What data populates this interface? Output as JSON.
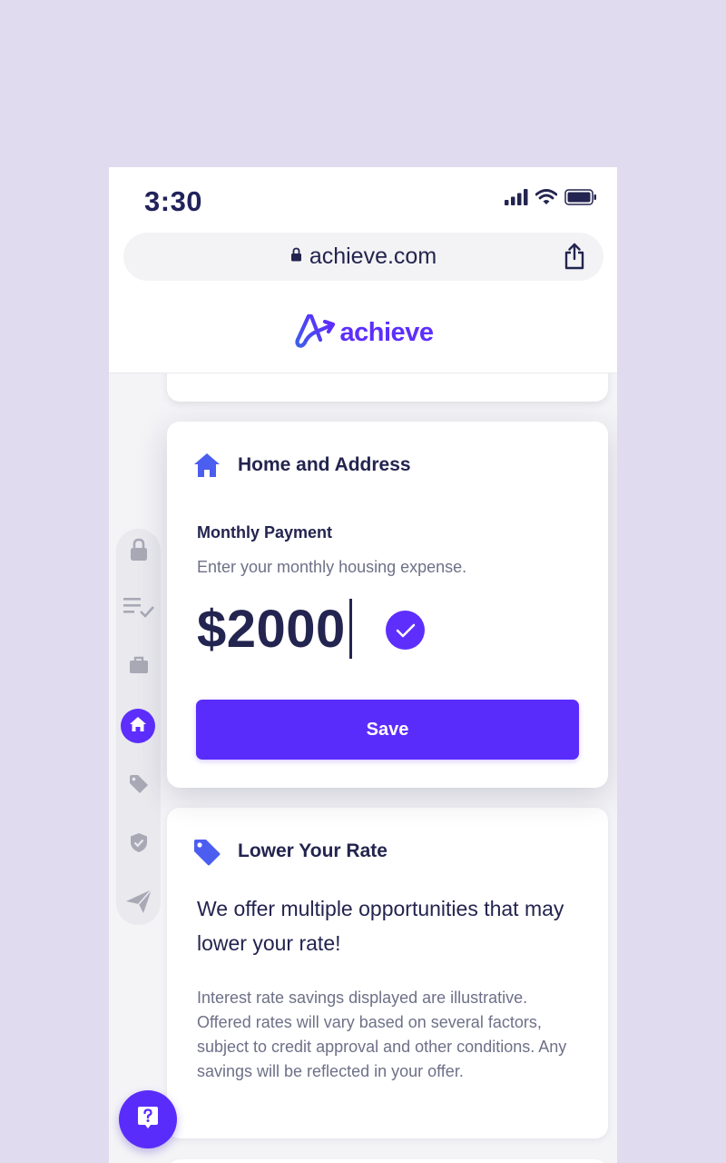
{
  "status_bar": {
    "time": "3:30"
  },
  "browser": {
    "url": "achieve.com"
  },
  "brand": {
    "name": "achieve"
  },
  "home_card": {
    "title": "Home and Address",
    "field_label": "Monthly Payment",
    "field_help": "Enter your monthly housing expense.",
    "value": "$2000",
    "save_label": "Save"
  },
  "rate_card": {
    "title": "Lower Your Rate",
    "headline": "We offer multiple opportunities that may lower your rate!",
    "body": "Interest rate savings displayed are illustrative. Offered rates will vary based on several factors, subject to credit approval and other conditions. Any savings will be reflected in your offer."
  },
  "stepper": {
    "steps": [
      "lock-icon",
      "checklist-icon",
      "briefcase-icon",
      "home-icon",
      "tag-icon",
      "shield-check-icon",
      "send-icon"
    ],
    "active_step": "home-icon"
  },
  "colors": {
    "accent": "#5d2efc",
    "brand_blue": "#3f5ee8",
    "text_dark": "#23244f",
    "text_muted": "#6e7088",
    "page_bg": "#e0dbef"
  }
}
